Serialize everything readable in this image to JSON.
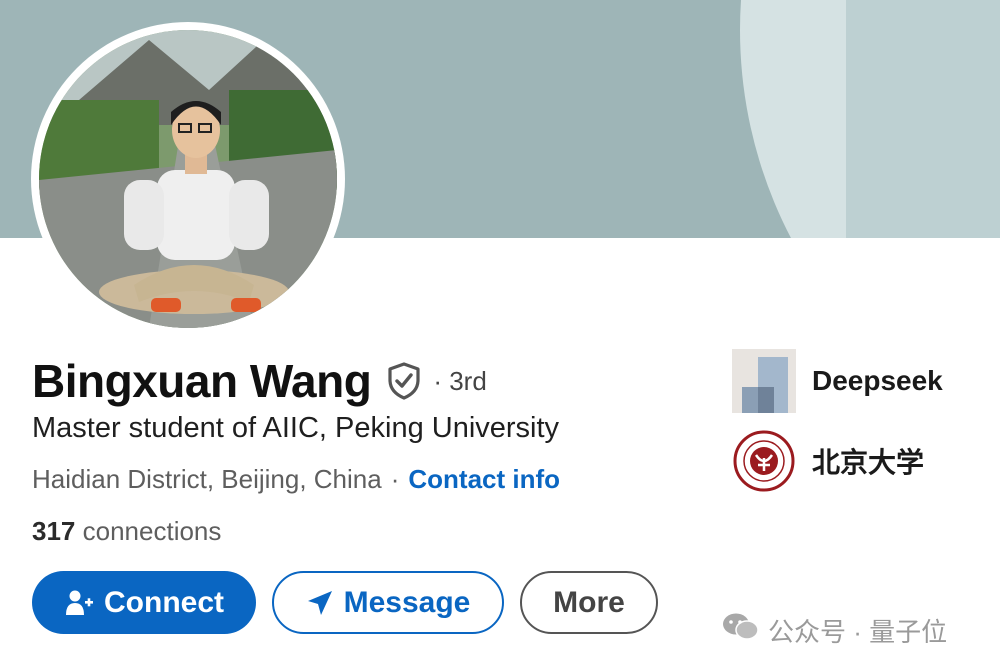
{
  "profile": {
    "name": "Bingxuan Wang",
    "degree": "· 3rd",
    "headline": "Master student of AIIC, Peking University",
    "location": "Haidian District, Beijing, China",
    "location_sep": "·",
    "contact_info": "Contact info",
    "connections_count": "317",
    "connections_label": "connections"
  },
  "actions": {
    "connect": "Connect",
    "message": "Message",
    "more": "More"
  },
  "organizations": [
    {
      "name": "Deepseek"
    },
    {
      "name": "北京大学"
    }
  ],
  "watermark": {
    "text": "公众号 · 量子位"
  },
  "colors": {
    "accent": "#0a66c2",
    "cover": "#9eb5b7",
    "text": "#1a1a1a",
    "muted": "#5e5e5e"
  },
  "icons": {
    "verified": "shield-check-icon",
    "connect": "person-add-icon",
    "message": "paper-plane-icon",
    "watermark": "wechat-icon"
  }
}
